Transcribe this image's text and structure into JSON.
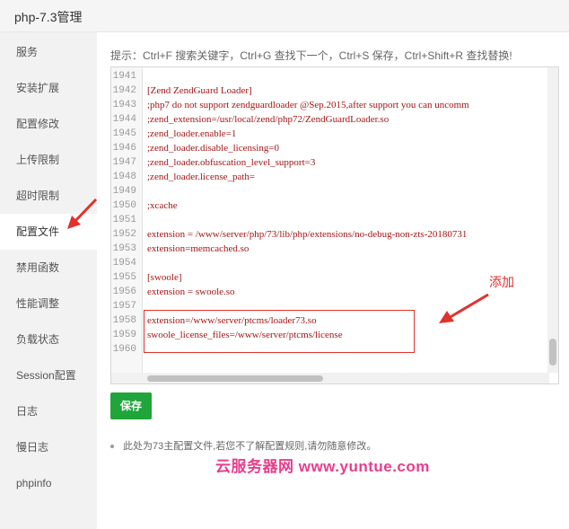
{
  "window": {
    "title": "php-7.3管理"
  },
  "sidebar": {
    "items": [
      {
        "label": "服务",
        "active": false
      },
      {
        "label": "安装扩展",
        "active": false
      },
      {
        "label": "配置修改",
        "active": false
      },
      {
        "label": "上传限制",
        "active": false
      },
      {
        "label": "超时限制",
        "active": false
      },
      {
        "label": "配置文件",
        "active": true
      },
      {
        "label": "禁用函数",
        "active": false
      },
      {
        "label": "性能调整",
        "active": false
      },
      {
        "label": "负载状态",
        "active": false
      },
      {
        "label": "Session配置",
        "active": false
      },
      {
        "label": "日志",
        "active": false
      },
      {
        "label": "慢日志",
        "active": false
      },
      {
        "label": "phpinfo",
        "active": false
      }
    ]
  },
  "main": {
    "tip": "提示：Ctrl+F 搜索关键字，Ctrl+G 查找下一个，Ctrl+S 保存，Ctrl+Shift+R 查找替换!",
    "editor": {
      "lines": [
        {
          "no": "1941",
          "text": ""
        },
        {
          "no": "1942",
          "text": "[Zend ZendGuard Loader]"
        },
        {
          "no": "1943",
          "text": ";php7 do not support zendguardloader @Sep.2015,after support you can uncomm"
        },
        {
          "no": "1944",
          "text": ";zend_extension=/usr/local/zend/php72/ZendGuardLoader.so"
        },
        {
          "no": "1945",
          "text": ";zend_loader.enable=1"
        },
        {
          "no": "1946",
          "text": ";zend_loader.disable_licensing=0"
        },
        {
          "no": "1947",
          "text": ";zend_loader.obfuscation_level_support=3"
        },
        {
          "no": "1948",
          "text": ";zend_loader.license_path="
        },
        {
          "no": "1949",
          "text": ""
        },
        {
          "no": "1950",
          "text": ";xcache"
        },
        {
          "no": "1951",
          "text": ""
        },
        {
          "no": "1952",
          "text": "extension = /www/server/php/73/lib/php/extensions/no-debug-non-zts-20180731"
        },
        {
          "no": "1953",
          "text": "extension=memcached.so"
        },
        {
          "no": "1954",
          "text": ""
        },
        {
          "no": "1955",
          "text": "[swoole]"
        },
        {
          "no": "1956",
          "text": "extension = swoole.so"
        },
        {
          "no": "1957",
          "text": ""
        },
        {
          "no": "1958",
          "text": "extension=/www/server/ptcms/loader73.so"
        },
        {
          "no": "1959",
          "text": "swoole_license_files=/www/server/ptcms/license"
        },
        {
          "no": "1960",
          "text": ""
        }
      ]
    },
    "annotation": "添加",
    "save_label": "保存",
    "note": "此处为73主配置文件,若您不了解配置规则,请勿随意修改。"
  },
  "watermark": "云服务器网 www.yuntue.com",
  "colors": {
    "accent": "#20a53a",
    "annotation": "#e0322f",
    "code": "#a31515",
    "watermark": "#e83e8c"
  }
}
